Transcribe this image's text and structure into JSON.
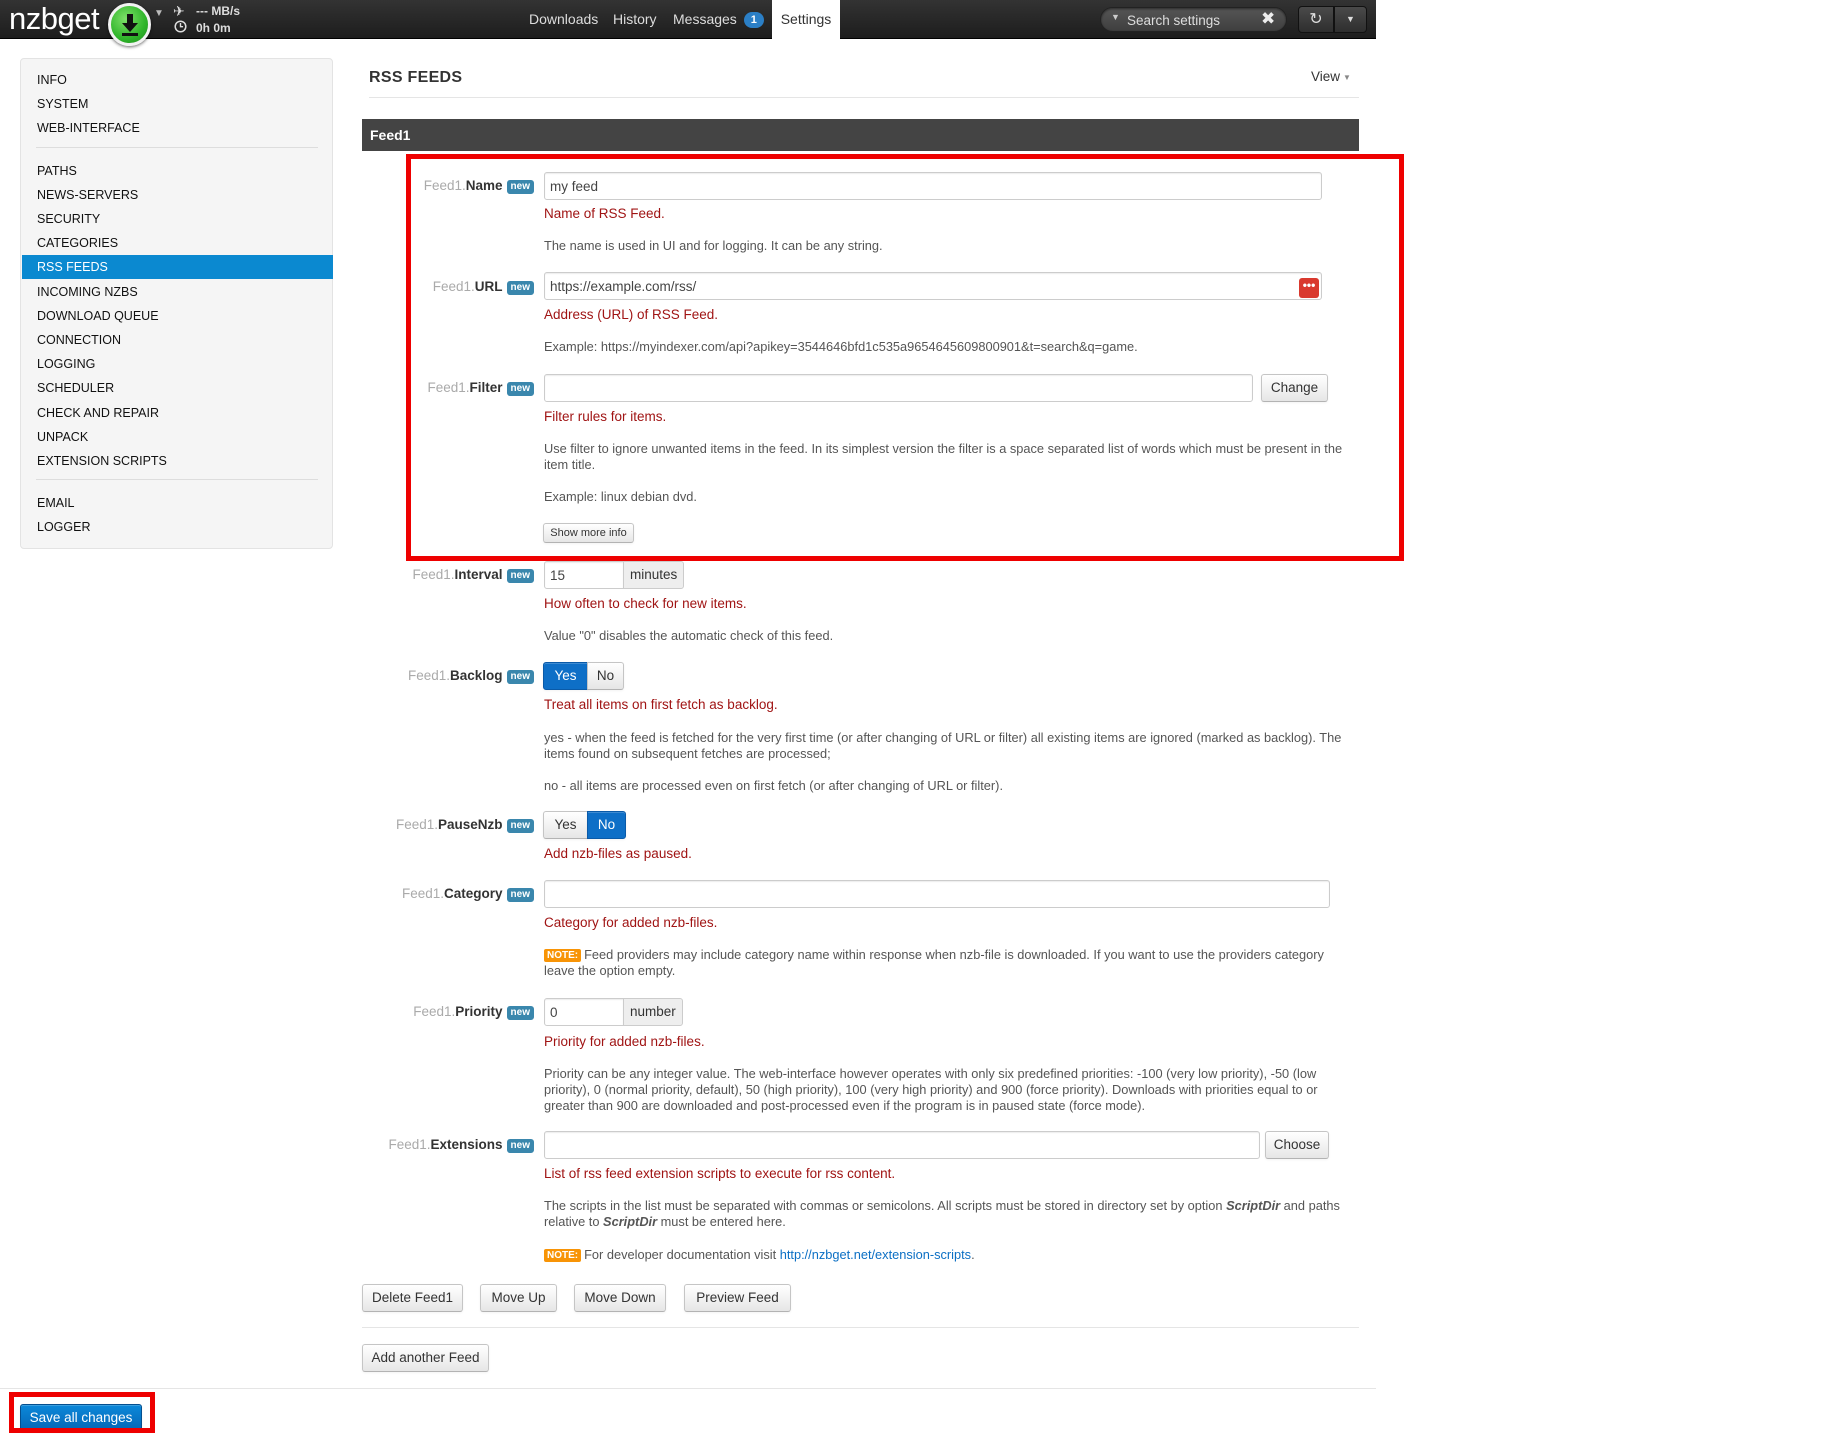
{
  "navbar": {
    "logo": "nzbget",
    "speed": "--- MB/s",
    "time_left": "0h 0m",
    "tabs": {
      "downloads": "Downloads",
      "history": "History",
      "messages": "Messages",
      "messages_count": "1",
      "settings": "Settings"
    },
    "search_placeholder": "Search settings"
  },
  "sidebar": {
    "group1": [
      "INFO",
      "SYSTEM",
      "WEB-INTERFACE"
    ],
    "group2": [
      "PATHS",
      "NEWS-SERVERS",
      "SECURITY",
      "CATEGORIES",
      "RSS FEEDS",
      "INCOMING NZBS",
      "DOWNLOAD QUEUE",
      "CONNECTION",
      "LOGGING",
      "SCHEDULER",
      "CHECK AND REPAIR",
      "UNPACK",
      "EXTENSION SCRIPTS"
    ],
    "group3": [
      "EMAIL",
      "LOGGER"
    ],
    "active": "RSS FEEDS"
  },
  "main": {
    "title": "RSS FEEDS",
    "view_menu": "View",
    "section": "Feed1",
    "prefix": "Feed1.",
    "new_badge": "new",
    "note_badge": "NOTE:",
    "name": {
      "label": "Name",
      "value": "my feed",
      "summary": "Name of RSS Feed.",
      "desc": "The name is used in UI and for logging. It can be any string."
    },
    "url": {
      "label": "URL",
      "value": "https://example.com/rss/",
      "summary": "Address (URL) of RSS Feed.",
      "desc": "Example: https://myindexer.com/api?apikey=3544646bfd1c535a9654645609800901&t=search&q=game."
    },
    "filter": {
      "label": "Filter",
      "value": "",
      "button": "Change",
      "summary": "Filter rules for items.",
      "desc": "Use filter to ignore unwanted items in the feed. In its simplest version the filter is a space separated list of words which must be present in the item title.",
      "example": "Example: linux debian dvd.",
      "more_button": "Show more info"
    },
    "interval": {
      "label": "Interval",
      "value": "15",
      "unit": "minutes",
      "summary": "How often to check for new items.",
      "desc": "Value \"0\" disables the automatic check of this feed."
    },
    "backlog": {
      "label": "Backlog",
      "yes": "Yes",
      "no": "No",
      "selected": "Yes",
      "summary": "Treat all items on first fetch as backlog.",
      "desc_yes": "yes - when the feed is fetched for the very first time (or after changing of URL or filter) all existing items are ignored (marked as backlog). The items found on subsequent fetches are processed;",
      "desc_no": "no - all items are processed even on first fetch (or after changing of URL or filter)."
    },
    "pausenzb": {
      "label": "PauseNzb",
      "yes": "Yes",
      "no": "No",
      "selected": "No",
      "summary": "Add nzb-files as paused."
    },
    "category": {
      "label": "Category",
      "value": "",
      "summary": "Category for added nzb-files.",
      "note": "Feed providers may include category name within response when nzb-file is downloaded. If you want to use the providers category leave the option empty."
    },
    "priority": {
      "label": "Priority",
      "value": "0",
      "unit": "number",
      "summary": "Priority for added nzb-files.",
      "desc": "Priority can be any integer value. The web-interface however operates with only six predefined priorities: -100 (very low priority), -50 (low priority), 0 (normal priority, default), 50 (high priority), 100 (very high priority) and 900 (force priority). Downloads with priorities equal to or greater than 900 are downloaded and post-processed even if the program is in paused state (force mode)."
    },
    "extensions": {
      "label": "Extensions",
      "value": "",
      "button": "Choose",
      "summary": "List of rss feed extension scripts to execute for rss content.",
      "desc_a": "The scripts in the list must be separated with commas or semicolons. All scripts must be stored in directory set by option ",
      "desc_b": "ScriptDir",
      "desc_c": " and paths relative to ",
      "desc_d": "ScriptDir",
      "desc_e": " must be entered here.",
      "note_text": "For developer documentation visit ",
      "note_link": "http://nzbget.net/extension-scripts",
      "note_end": "."
    },
    "actions": {
      "delete": "Delete Feed1",
      "move_up": "Move Up",
      "move_down": "Move Down",
      "preview": "Preview Feed",
      "add": "Add another Feed"
    },
    "save": "Save all changes"
  },
  "colors": {
    "accent": "#0b89d0",
    "highlight": "#ee0000",
    "navbar": "#222222",
    "section": "#444444"
  }
}
